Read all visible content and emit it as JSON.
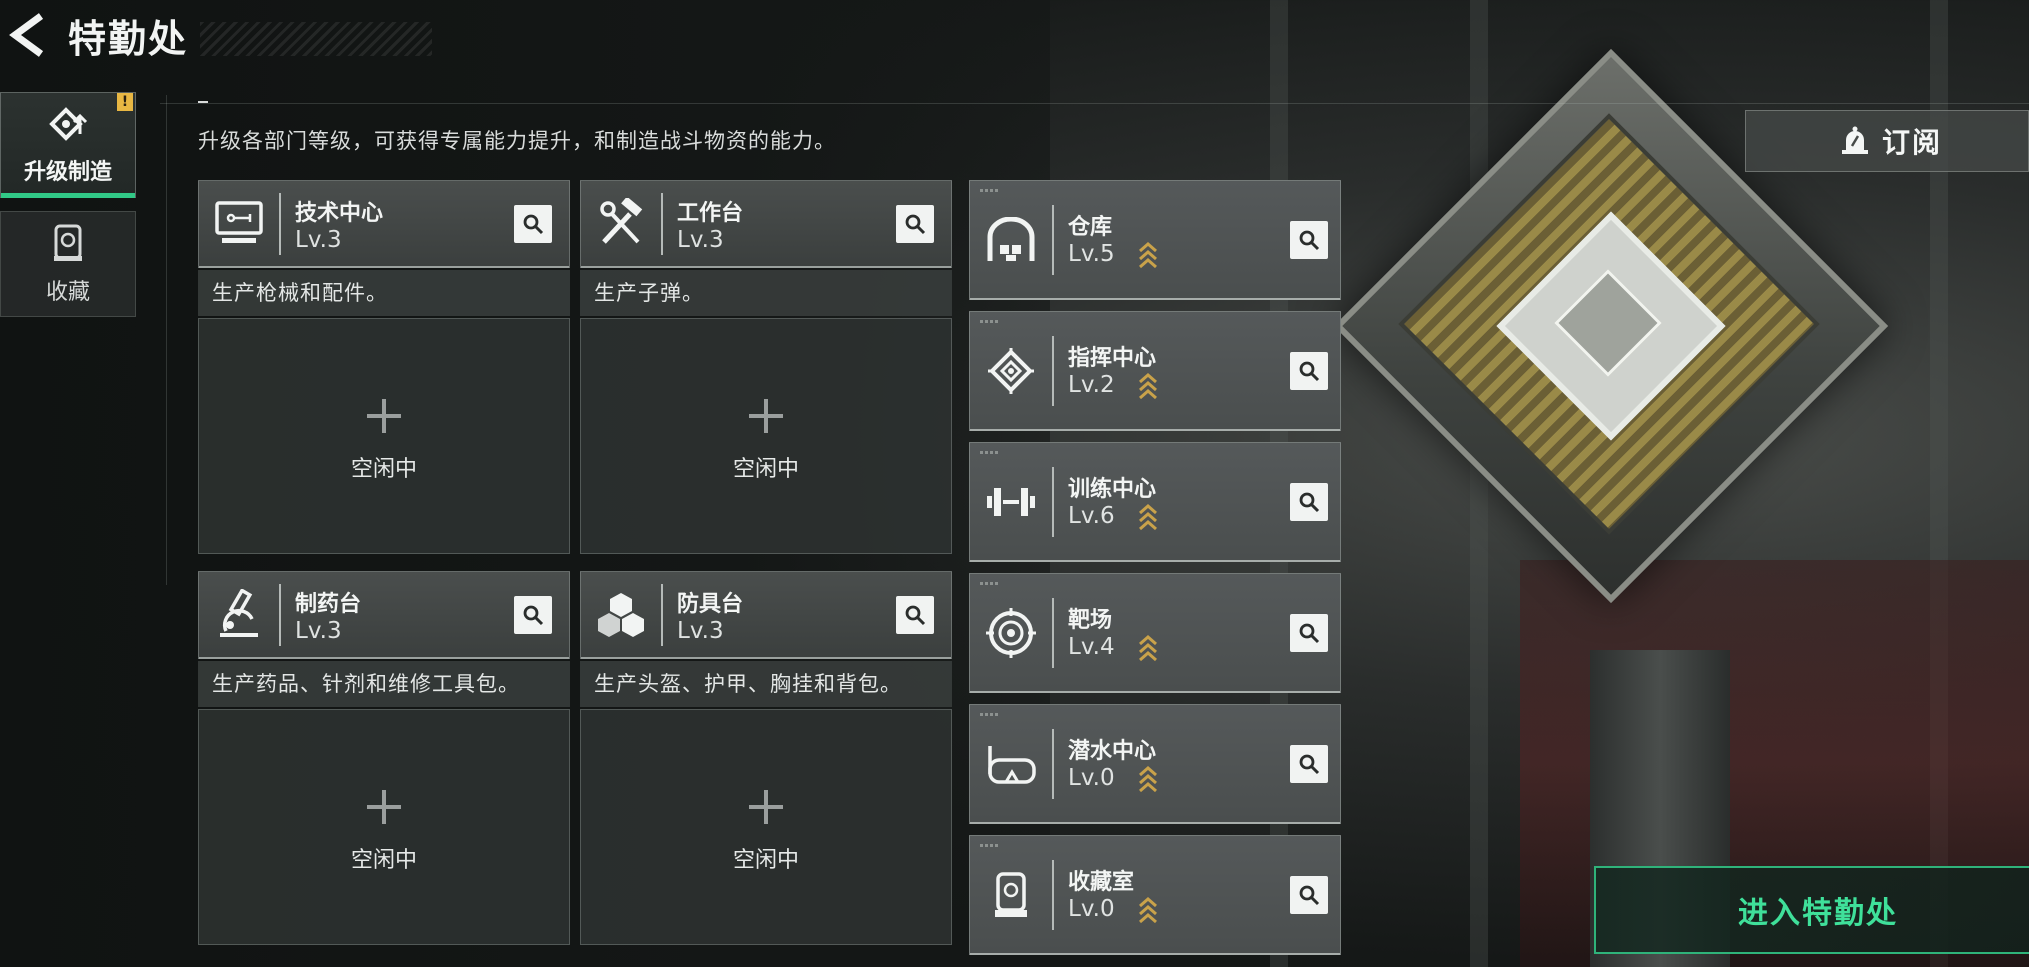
{
  "header": {
    "title": "特勤处",
    "back_icon": "back-arrow-icon"
  },
  "side_nav": {
    "items": [
      {
        "label": "升级制造",
        "icon": "upgrade-icon",
        "active": true,
        "badge": "!"
      },
      {
        "label": "收藏",
        "icon": "collection-icon",
        "active": false
      }
    ]
  },
  "description": "升级各部门等级，可获得专属能力提升，和制造战斗物资的能力。",
  "workshops": [
    {
      "name": "技术中心",
      "level": "Lv.3",
      "icon": "monitor-icon",
      "desc": "生产枪械和配件。",
      "slot_status": "空闲中"
    },
    {
      "name": "工作台",
      "level": "Lv.3",
      "icon": "tools-icon",
      "desc": "生产子弹。",
      "slot_status": "空闲中"
    },
    {
      "name": "制药台",
      "level": "Lv.3",
      "icon": "microscope-icon",
      "desc": "生产药品、针剂和维修工具包。",
      "slot_status": "空闲中"
    },
    {
      "name": "防具台",
      "level": "Lv.3",
      "icon": "cubes-icon",
      "desc": "生产头盔、护甲、胸挂和背包。",
      "slot_status": "空闲中"
    }
  ],
  "departments": [
    {
      "name": "仓库",
      "level": "Lv.5",
      "icon": "warehouse-icon"
    },
    {
      "name": "指挥中心",
      "level": "Lv.2",
      "icon": "chip-icon"
    },
    {
      "name": "训练中心",
      "level": "Lv.6",
      "icon": "dumbbell-icon"
    },
    {
      "name": "靶场",
      "level": "Lv.4",
      "icon": "target-icon"
    },
    {
      "name": "潜水中心",
      "level": "Lv.0",
      "icon": "diving-mask-icon"
    },
    {
      "name": "收藏室",
      "level": "Lv.0",
      "icon": "display-case-icon"
    }
  ],
  "subscribe": {
    "label": "订阅",
    "icon": "bell-icon"
  },
  "enter_button": {
    "label": "进入特勤处"
  },
  "colors": {
    "accent_green": "#31c987",
    "enter_text": "#3fe09a",
    "upgrade_arrow": "#c9a24a",
    "badge": "#e8b743"
  }
}
